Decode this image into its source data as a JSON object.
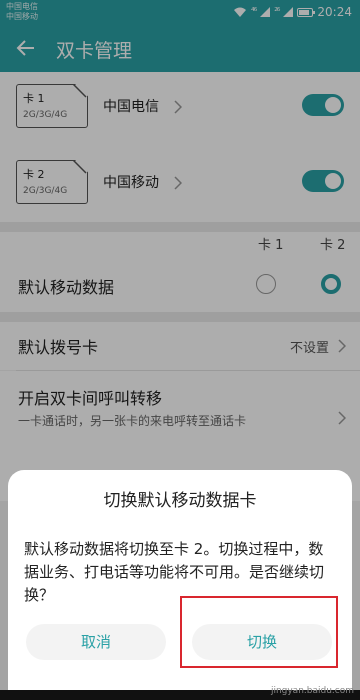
{
  "status_bar": {
    "carrier1": "中国电信",
    "carrier2": "中国移动",
    "net1": "⁴⁶",
    "net2": "²⁶",
    "time": "20:24",
    "battery_level": 0.8
  },
  "app_bar": {
    "title": "双卡管理"
  },
  "sims": [
    {
      "num": "卡 1",
      "gen": "2G/3G/4G",
      "carrier": "中国电信",
      "enabled": true
    },
    {
      "num": "卡 2",
      "gen": "2G/3G/4G",
      "carrier": "中国移动",
      "enabled": true
    }
  ],
  "columns": {
    "sim1": "卡 1",
    "sim2": "卡 2"
  },
  "default_data": {
    "label": "默认移动数据",
    "selected": "sim2"
  },
  "default_dial": {
    "label": "默认拨号卡",
    "value": "不设置"
  },
  "forwarding": {
    "label": "开启双卡间呼叫转移",
    "sub": "一卡通话时，另一张卡的来电呼转至通话卡"
  },
  "dialog": {
    "title": "切换默认移动数据卡",
    "body": "默认移动数据将切换至卡 2。切换过程中，数据业务、打电话等功能将不可用。是否继续切换？",
    "cancel": "取消",
    "confirm": "切换"
  },
  "watermark": "jingyan.baidu.com",
  "colors": {
    "accent": "#2aa1a6",
    "highlight": "#d9262e"
  }
}
